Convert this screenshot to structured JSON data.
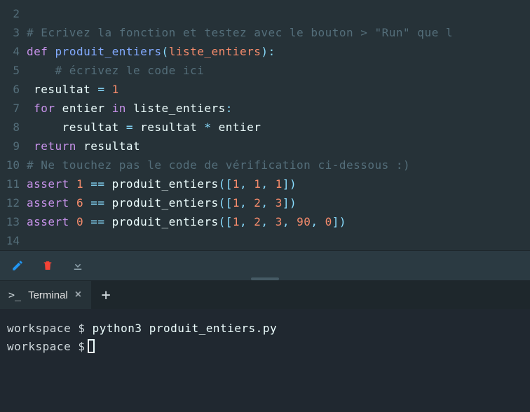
{
  "editor": {
    "lines": [
      {
        "num": "2",
        "tokens": []
      },
      {
        "num": "3",
        "tokens": [
          {
            "t": "cm",
            "v": "# Ecrivez la fonction et testez avec le bouton > \"Run\" que l"
          }
        ]
      },
      {
        "num": "4",
        "tokens": [
          {
            "t": "kw",
            "v": "def"
          },
          {
            "t": "id",
            "v": " "
          },
          {
            "t": "fn",
            "v": "produit_entiers"
          },
          {
            "t": "op",
            "v": "("
          },
          {
            "t": "pr",
            "v": "liste_entiers"
          },
          {
            "t": "op",
            "v": ")"
          },
          {
            "t": "op",
            "v": ":"
          }
        ]
      },
      {
        "num": "5",
        "tokens": [
          {
            "t": "id",
            "v": "    "
          },
          {
            "t": "cm",
            "v": "# écrivez le code ici"
          }
        ]
      },
      {
        "num": "6",
        "tokens": [
          {
            "t": "id",
            "v": " resultat "
          },
          {
            "t": "op",
            "v": "="
          },
          {
            "t": "id",
            "v": " "
          },
          {
            "t": "nu",
            "v": "1"
          }
        ]
      },
      {
        "num": "7",
        "tokens": [
          {
            "t": "id",
            "v": " "
          },
          {
            "t": "kw",
            "v": "for"
          },
          {
            "t": "id",
            "v": " entier "
          },
          {
            "t": "kw",
            "v": "in"
          },
          {
            "t": "id",
            "v": " liste_entiers"
          },
          {
            "t": "op",
            "v": ":"
          }
        ]
      },
      {
        "num": "8",
        "tokens": [
          {
            "t": "id",
            "v": "     resultat "
          },
          {
            "t": "op",
            "v": "="
          },
          {
            "t": "id",
            "v": " resultat "
          },
          {
            "t": "op",
            "v": "*"
          },
          {
            "t": "id",
            "v": " entier"
          }
        ]
      },
      {
        "num": "9",
        "tokens": [
          {
            "t": "id",
            "v": " "
          },
          {
            "t": "kw",
            "v": "return"
          },
          {
            "t": "id",
            "v": " resultat"
          }
        ]
      },
      {
        "num": "10",
        "tokens": [
          {
            "t": "cm",
            "v": "# Ne touchez pas le code de vérification ci-dessous :)"
          }
        ]
      },
      {
        "num": "11",
        "tokens": [
          {
            "t": "kw",
            "v": "assert"
          },
          {
            "t": "id",
            "v": " "
          },
          {
            "t": "nu",
            "v": "1"
          },
          {
            "t": "id",
            "v": " "
          },
          {
            "t": "op",
            "v": "=="
          },
          {
            "t": "id",
            "v": " produit_entiers"
          },
          {
            "t": "op",
            "v": "(["
          },
          {
            "t": "nu",
            "v": "1"
          },
          {
            "t": "op",
            "v": ", "
          },
          {
            "t": "nu",
            "v": "1"
          },
          {
            "t": "op",
            "v": ", "
          },
          {
            "t": "nu",
            "v": "1"
          },
          {
            "t": "op",
            "v": "])"
          }
        ]
      },
      {
        "num": "12",
        "tokens": [
          {
            "t": "kw",
            "v": "assert"
          },
          {
            "t": "id",
            "v": " "
          },
          {
            "t": "nu",
            "v": "6"
          },
          {
            "t": "id",
            "v": " "
          },
          {
            "t": "op",
            "v": "=="
          },
          {
            "t": "id",
            "v": " produit_entiers"
          },
          {
            "t": "op",
            "v": "(["
          },
          {
            "t": "nu",
            "v": "1"
          },
          {
            "t": "op",
            "v": ", "
          },
          {
            "t": "nu",
            "v": "2"
          },
          {
            "t": "op",
            "v": ", "
          },
          {
            "t": "nu",
            "v": "3"
          },
          {
            "t": "op",
            "v": "])"
          }
        ]
      },
      {
        "num": "13",
        "tokens": [
          {
            "t": "kw",
            "v": "assert"
          },
          {
            "t": "id",
            "v": " "
          },
          {
            "t": "nu",
            "v": "0"
          },
          {
            "t": "id",
            "v": " "
          },
          {
            "t": "op",
            "v": "=="
          },
          {
            "t": "id",
            "v": " produit_entiers"
          },
          {
            "t": "op",
            "v": "(["
          },
          {
            "t": "nu",
            "v": "1"
          },
          {
            "t": "op",
            "v": ", "
          },
          {
            "t": "nu",
            "v": "2"
          },
          {
            "t": "op",
            "v": ", "
          },
          {
            "t": "nu",
            "v": "3"
          },
          {
            "t": "op",
            "v": ", "
          },
          {
            "t": "nu",
            "v": "90"
          },
          {
            "t": "op",
            "v": ", "
          },
          {
            "t": "nu",
            "v": "0"
          },
          {
            "t": "op",
            "v": "])"
          }
        ]
      },
      {
        "num": "14",
        "tokens": []
      }
    ]
  },
  "toolbar": {
    "icons": [
      "pencil-icon",
      "trash-icon",
      "download-icon"
    ]
  },
  "tabs": {
    "terminal_label": "Terminal",
    "terminal_prefix": ">_",
    "close_glyph": "×",
    "add_glyph": "+"
  },
  "terminal": {
    "prompt_path": "workspace",
    "prompt_symbol": "$",
    "command": "python3 produit_entiers.py"
  }
}
